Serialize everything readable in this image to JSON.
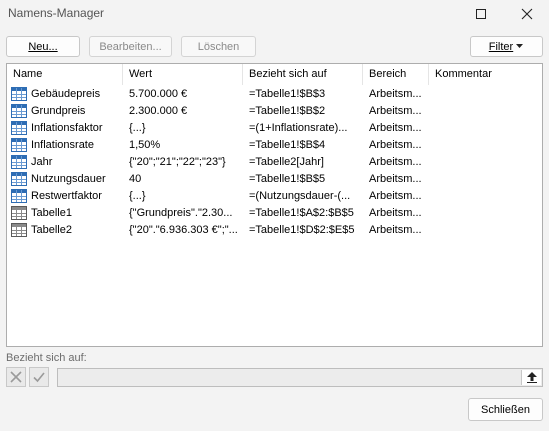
{
  "window": {
    "title": "Namens-Manager"
  },
  "toolbar": {
    "new_label": "Neu...",
    "edit_label": "Bearbeiten...",
    "delete_label": "Löschen",
    "filter_label": "Filter"
  },
  "columns": {
    "name": "Name",
    "value": "Wert",
    "refers_to": "Bezieht sich auf",
    "scope": "Bereich",
    "comment": "Kommentar"
  },
  "rows": [
    {
      "icon": "named-range-icon",
      "name": "Gebäudepreis",
      "value": "5.700.000 €",
      "refers_to": "=Tabelle1!$B$3",
      "scope": "Arbeitsm...",
      "comment": ""
    },
    {
      "icon": "named-range-icon",
      "name": "Grundpreis",
      "value": "2.300.000 €",
      "refers_to": "=Tabelle1!$B$2",
      "scope": "Arbeitsm...",
      "comment": ""
    },
    {
      "icon": "named-range-icon",
      "name": "Inflationsfaktor",
      "value": "{...}",
      "refers_to": "=(1+Inflationsrate)...",
      "scope": "Arbeitsm...",
      "comment": ""
    },
    {
      "icon": "named-range-icon",
      "name": "Inflationsrate",
      "value": "1,50%",
      "refers_to": "=Tabelle1!$B$4",
      "scope": "Arbeitsm...",
      "comment": ""
    },
    {
      "icon": "named-range-icon",
      "name": "Jahr",
      "value": "{\"20\";\"21\";\"22\";\"23\"}",
      "refers_to": "=Tabelle2[Jahr]",
      "scope": "Arbeitsm...",
      "comment": ""
    },
    {
      "icon": "named-range-icon",
      "name": "Nutzungsdauer",
      "value": "40",
      "refers_to": "=Tabelle1!$B$5",
      "scope": "Arbeitsm...",
      "comment": ""
    },
    {
      "icon": "named-range-icon",
      "name": "Restwertfaktor",
      "value": "{...}",
      "refers_to": "=(Nutzungsdauer-(...",
      "scope": "Arbeitsm...",
      "comment": ""
    },
    {
      "icon": "table-icon",
      "name": "Tabelle1",
      "value": "{\"Grundpreis\".\"2.30...",
      "refers_to": "=Tabelle1!$A$2:$B$5",
      "scope": "Arbeitsm...",
      "comment": ""
    },
    {
      "icon": "table-icon",
      "name": "Tabelle2",
      "value": "{\"20\".\"6.936.303 €\";\"...",
      "refers_to": "=Tabelle1!$D$2:$E$5",
      "scope": "Arbeitsm...",
      "comment": ""
    }
  ],
  "refers_to_section": {
    "label": "Bezieht sich auf:",
    "value": ""
  },
  "footer": {
    "close_label": "Schließen"
  }
}
